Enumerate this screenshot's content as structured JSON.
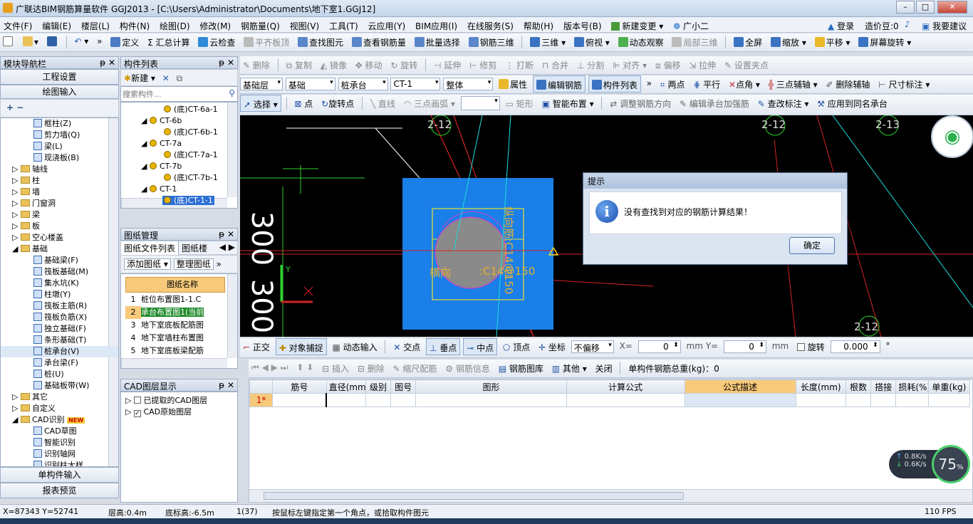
{
  "title": "广联达BIM钢筋算量软件 GGJ2013 - [C:\\Users\\Administrator\\Documents\\地下室1.GGJ12]",
  "menu": [
    "文件(F)",
    "编辑(E)",
    "楼层(L)",
    "构件(N)",
    "绘图(D)",
    "修改(M)",
    "钢筋量(Q)",
    "视图(V)",
    "工具(T)",
    "云应用(Y)",
    "BIM应用(I)",
    "在线服务(S)",
    "帮助(H)",
    "版本号(B)",
    "新建变更",
    "广小二"
  ],
  "menu_right": [
    "登录",
    "造价豆:0",
    "我要建议"
  ],
  "toolbar1": [
    "定义",
    "汇总计算",
    "云检查",
    "平齐板顶",
    "查找图元",
    "查看钢筋量",
    "批量选择",
    "钢筋三维",
    "三维",
    "俯视",
    "动态观察",
    "局部三维",
    "全屏",
    "缩放",
    "平移",
    "屏幕旋转"
  ],
  "toolbar2": [
    "删除",
    "复制",
    "镜像",
    "移动",
    "旋转",
    "延伸",
    "修剪",
    "打断",
    "合并",
    "分割",
    "对齐",
    "偏移",
    "拉伸",
    "设置夹点"
  ],
  "toolbar3": {
    "floor": "基础层",
    "category": "基础",
    "type": "桩承台",
    "item": "CT-1",
    "scope": "整体",
    "buttons": [
      "属性",
      "编辑钢筋",
      "构件列表"
    ],
    "right": [
      "两点",
      "平行",
      "点角",
      "三点辅轴",
      "删除辅轴",
      "尺寸标注"
    ]
  },
  "toolbar4": [
    "选择",
    "点",
    "旋转点",
    "直线",
    "三点画弧",
    "矩形",
    "智能布置",
    "调整钢筋方向",
    "编辑承台加强筋",
    "查改标注",
    "应用到同名承台"
  ],
  "nav": {
    "title": "模块导航栏",
    "btn1": "工程设置",
    "btn2": "绘图输入",
    "items": [
      "框柱(Z)",
      "剪力墙(Q)",
      "梁(L)",
      "现浇板(B)",
      "轴线",
      "柱",
      "墙",
      "门窗洞",
      "梁",
      "板",
      "空心楼盖",
      "基础",
      "基础梁(F)",
      "筏板基础(M)",
      "集水坑(K)",
      "柱墩(Y)",
      "筏板主筋(R)",
      "筏板负筋(X)",
      "独立基础(F)",
      "条形基础(T)",
      "桩承台(V)",
      "承台梁(F)",
      "桩(U)",
      "基础板带(W)",
      "其它",
      "自定义",
      "CAD识别",
      "CAD草图",
      "智能识别",
      "识别轴网",
      "识别柱大样"
    ],
    "new_badge": "NEW",
    "bottom1": "单构件输入",
    "bottom2": "报表预览"
  },
  "complist": {
    "title": "构件列表",
    "new_btn": "新建",
    "search_placeholder": "搜索构件...",
    "items": [
      "(底)CT-6a-1",
      "CT-6b",
      "(底)CT-6b-1",
      "CT-7a",
      "(底)CT-7a-1",
      "CT-7b",
      "(底)CT-7b-1",
      "CT-1",
      "(底)CT-1-1"
    ]
  },
  "drawing": {
    "title": "图纸管理",
    "tab1": "图纸文件列表",
    "tab2": "图纸楼",
    "add_btn": "添加图纸",
    "arrange_btn": "整理图纸",
    "col": "图纸名称",
    "rows": [
      {
        "no": "1",
        "name": "桩位布置图1-1.C"
      },
      {
        "no": "2",
        "name": "承台布置图1(当前"
      },
      {
        "no": "3",
        "name": "地下室底板配筋图"
      },
      {
        "no": "4",
        "name": "地下室墙柱布置图"
      },
      {
        "no": "5",
        "name": "地下室底板梁配筋"
      }
    ]
  },
  "cadlayer": {
    "title": "CAD图层显示",
    "items": [
      "已提取的CAD图层",
      "CAD原始图层"
    ]
  },
  "canvas": {
    "labels": [
      "2-12",
      "2-12",
      "2-13",
      "2-12"
    ],
    "annot1": "横向",
    "annot2": ":C14@150",
    "annot3": "纵向筋:C14@150",
    "big": "300"
  },
  "dialog": {
    "title": "提示",
    "message": "没有查找到对应的钢筋计算结果！",
    "ok": "确定"
  },
  "snapbar": {
    "items": [
      "正交",
      "对象捕捉",
      "动态输入",
      "交点",
      "垂点",
      "中点",
      "顶点",
      "坐标"
    ],
    "offset": "不偏移",
    "x_label": "X=",
    "x_val": "0",
    "y_label": "mm Y=",
    "y_val": "0",
    "mm": "mm",
    "rotate": "旋转",
    "rot_val": "0.000",
    "deg": "°"
  },
  "rebar": {
    "toolbar": [
      "插入",
      "删除",
      "缩尺配筋",
      "钢筋信息",
      "钢筋图库",
      "其他",
      "关闭"
    ],
    "total": "单构件钢筋总重(kg)：0",
    "headers": [
      "筋号",
      "直径(mm)",
      "级别",
      "图号",
      "图形",
      "计算公式",
      "公式描述",
      "长度(mm)",
      "根数",
      "搭接",
      "损耗(%)",
      "单重(kg)"
    ],
    "row1": "1*"
  },
  "status": {
    "coords": "X=87343 Y=52741",
    "floor_h": "层高:0.4m",
    "bottom_h": "底标高:-6.5m",
    "count": "1(37)",
    "hint": "按鼠标左键指定第一个角点，或拾取构件图元",
    "fps": "110 FPS"
  },
  "netmon": {
    "up": "0.8K/s",
    "down": "0.6K/s",
    "pct": "75",
    "pct_unit": "%"
  },
  "colors": {
    "canvas_bg": "#000000",
    "blue_block": "#1a7fe8",
    "dialog_bg": "#dbe4f1",
    "header_orange": "#f7c97a"
  }
}
